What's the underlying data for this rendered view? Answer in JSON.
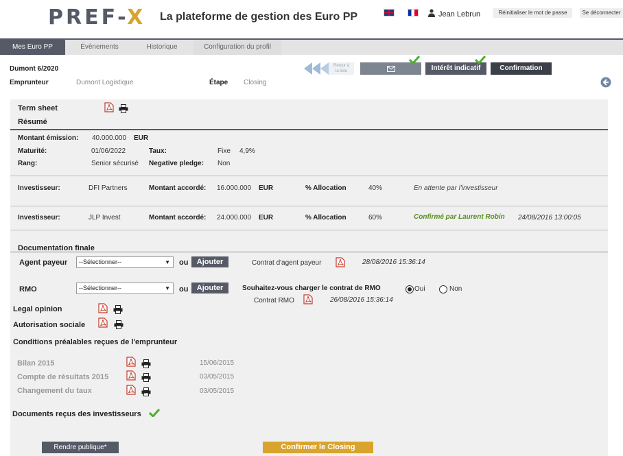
{
  "header": {
    "logo_left": "PREF-",
    "logo_right": "X",
    "platform_title": "La plateforme de gestion des Euro PP",
    "user_name": "Jean Lebrun",
    "reset_password": "Réinitialiser le mot de passe",
    "logout": "Se déconnecter"
  },
  "nav": {
    "tabs": [
      "Mes Euro PP",
      "Évènements",
      "Historique",
      "Configuration du profil"
    ]
  },
  "deal": {
    "name": "Dumont 6/2020",
    "borrower_label": "Emprunteur",
    "borrower_value": "Dumont Logistique",
    "stage_label": "Étape",
    "stage_value": "Closing",
    "back_label_1": "Retour à",
    "back_label_2": "la liste",
    "steps": [
      "Intérêt indicatif",
      "Confirmation"
    ]
  },
  "terms": {
    "term_sheet": "Term sheet",
    "summary": "Résumé",
    "amount_label": "Montant émission:",
    "amount_value": "40.000.000",
    "amount_ccy": "EUR",
    "maturity_label": "Maturité:",
    "maturity_value": "01/06/2022",
    "rate_label": "Taux:",
    "rate_type": "Fixe",
    "rate_value": "4,9%",
    "rank_label": "Rang:",
    "rank_value": "Senior sécurisé",
    "pledge_label": "Negative pledge:",
    "pledge_value": "Non"
  },
  "investors": [
    {
      "label": "Investisseur:",
      "name": "DFI Partners",
      "amount_label": "Montant accordé:",
      "amount": "16.000.000",
      "ccy": "EUR",
      "alloc_label": "% Allocation",
      "alloc": "40%",
      "status": "En attente par l'investisseur",
      "date": ""
    },
    {
      "label": "Investisseur:",
      "name": "JLP Invest",
      "amount_label": "Montant accordé:",
      "amount": "24.000.000",
      "ccy": "EUR",
      "alloc_label": "% Allocation",
      "alloc": "60%",
      "status": "Confirmé par Laurent Robin",
      "date": "24/08/2016  13:00:05"
    }
  ],
  "docs": {
    "section_title": "Documentation finale",
    "paying_agent_label": "Agent  payeur",
    "select_placeholder": "--Sélectionner--",
    "or": "ou",
    "add": "Ajouter",
    "paying_agent_contract": "Contrat d'agent  payeur",
    "paying_agent_date": "28/08/2016  15:36:14",
    "rmo_label": "RMO",
    "rmo_question": "Souhaitez-vous charger le contrat de RMO",
    "yes": "Oui",
    "no": "Non",
    "rmo_contract": "Contrat RMO",
    "rmo_date": "26/08/2016  15:36:14",
    "legal_opinion": "Legal opinion",
    "social_authorization": "Autorisation sociale"
  },
  "conditions": {
    "title": "Conditions préalables reçues de l'emprunteur",
    "items": [
      {
        "label": "Bilan 2015",
        "date": "15/06/2015"
      },
      {
        "label": "Compte de résultats 2015",
        "date": "03/05/2015"
      },
      {
        "label": "Changement du taux",
        "date": "03/05/2015"
      }
    ]
  },
  "investor_docs": {
    "title": "Documents reçus des investisseurs"
  },
  "actions": {
    "make_public": "Rendre publique*",
    "confirm_closing": "Confirmer le Closing"
  },
  "colors": {
    "brand_dark": "#555a66",
    "brand_gold": "#d8a42e",
    "confirm_green": "#5b8c1e",
    "pdf_red": "#c0392b",
    "check_green": "#4caf2a",
    "back_blue": "#9fbad6"
  }
}
